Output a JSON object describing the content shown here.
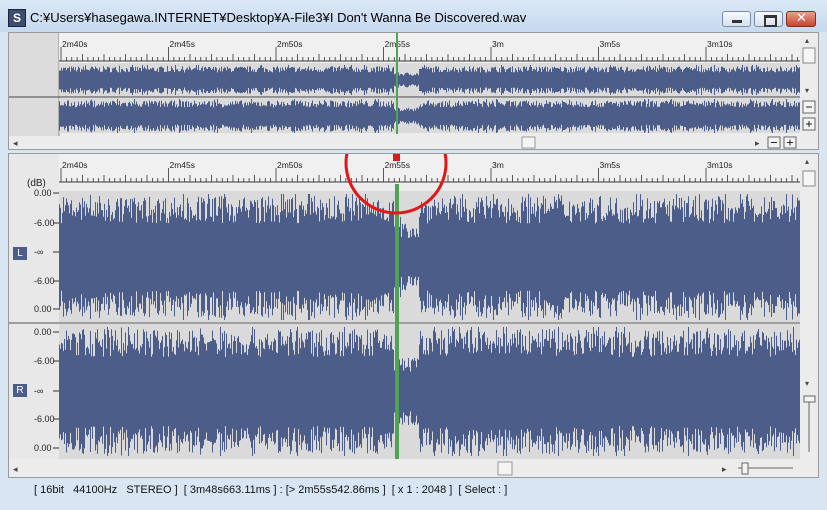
{
  "window": {
    "title": "C:¥Users¥hasegawa.INTERNET¥Desktop¥A-File3¥I Don't Wanna Be Discovered.wav",
    "app_icon": "S",
    "close_glyph": "✕"
  },
  "timeline": {
    "ticks": [
      "2m40s",
      "2m45s",
      "2m50s",
      "2m55s",
      "3m",
      "3m5s",
      "3m10s"
    ]
  },
  "db_scale": {
    "unit": "(dB)",
    "labels_left": [
      "0.00",
      "-6.00",
      "-∞",
      "-6.00",
      "0.00"
    ],
    "labels_right": [
      "0.00",
      "-6.00",
      "-∞",
      "-6.00",
      "0.00"
    ]
  },
  "channels": {
    "left": "L",
    "right": "R"
  },
  "status": "[ 16bit   44100Hz   STEREO ]  [ 3m48s663.11ms ] : [> 2m55s542.86ms ]  [ x 1 : 2048 ]  [ Select : ]",
  "colors": {
    "waveform": "#4c5d8a",
    "playhead": "#4fa352",
    "highlight_ring": "#e01818"
  }
}
